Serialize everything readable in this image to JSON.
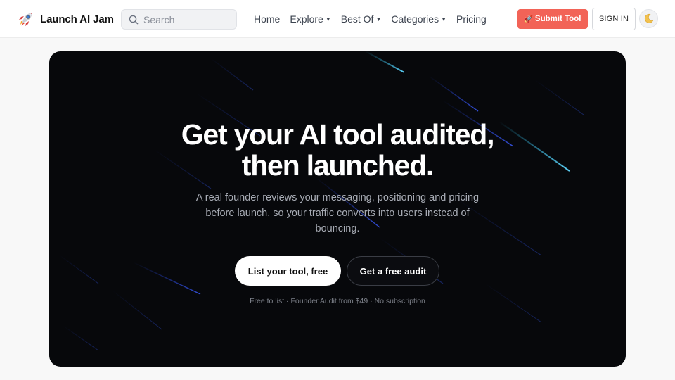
{
  "header": {
    "brand": {
      "icon": "rocket-icon",
      "name": "Launch AI Jam"
    },
    "search": {
      "placeholder": "Search",
      "value": "",
      "icon": "search-icon"
    },
    "nav": [
      {
        "label": "Home",
        "dropdown": false
      },
      {
        "label": "Explore",
        "dropdown": true
      },
      {
        "label": "Best Of",
        "dropdown": true
      },
      {
        "label": "Categories",
        "dropdown": true
      },
      {
        "label": "Pricing",
        "dropdown": false
      }
    ],
    "submit_button": {
      "emoji": "🚀",
      "label": "Submit Tool"
    },
    "signin_button": {
      "label": "SIGN IN"
    },
    "theme_toggle": {
      "icon": "moon-icon"
    }
  },
  "hero": {
    "title_line1": "Get your AI tool audited,",
    "title_line2": "then launched.",
    "description": "A real founder reviews your messaging, positioning and pricing before launch, so your traffic converts into users instead of bouncing.",
    "primary_cta": "List your tool, free",
    "secondary_cta": "Get a free audit",
    "note": "Free to list · Founder Audit from $49 · No subscription"
  },
  "colors": {
    "accent": "#f26357",
    "hero_background": "#07080b",
    "streak_cyan": "#22b8e6",
    "streak_blue": "#1f3fd6"
  }
}
